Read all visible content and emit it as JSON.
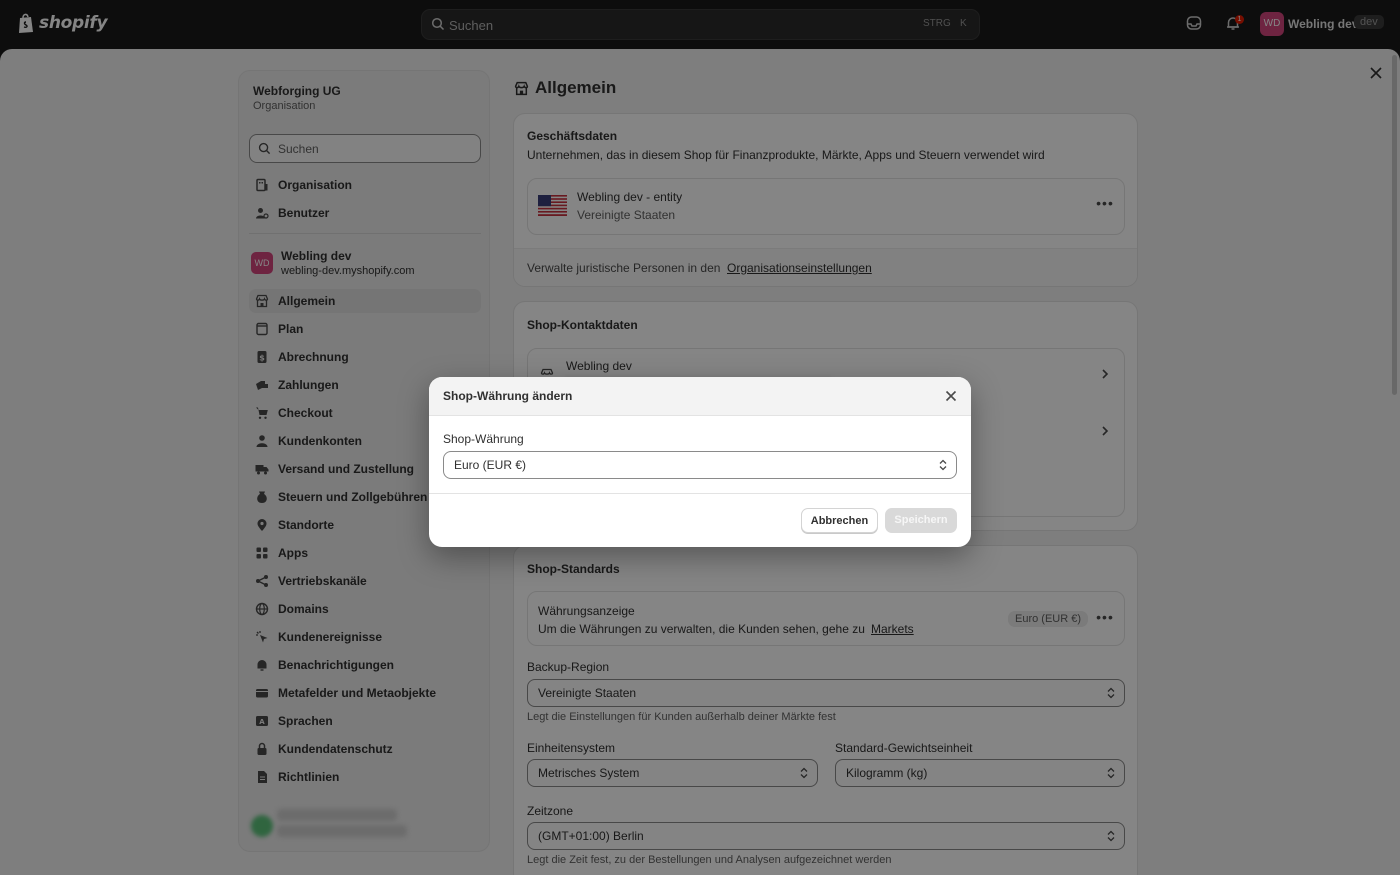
{
  "topbar": {
    "logo_text": "shopify",
    "search_placeholder": "Suchen",
    "shortcut_key1": "STRG",
    "shortcut_key2": "K",
    "notification_count": "1",
    "avatar_initials": "WD",
    "store_name": "Webling dev",
    "store_badge": "dev"
  },
  "sidebar": {
    "org_name": "Webforging UG",
    "org_subtitle": "Organisation",
    "search_placeholder": "Suchen",
    "org_items": [
      {
        "label": "Organisation",
        "icon": "building-icon"
      },
      {
        "label": "Benutzer",
        "icon": "user-icon"
      }
    ],
    "store": {
      "avatar": "WD",
      "name": "Webling dev",
      "url": "webling-dev.myshopify.com"
    },
    "items": [
      {
        "label": "Allgemein",
        "icon": "store-icon",
        "active": true
      },
      {
        "label": "Plan",
        "icon": "plan-icon"
      },
      {
        "label": "Abrechnung",
        "icon": "billing-icon"
      },
      {
        "label": "Zahlungen",
        "icon": "payments-icon"
      },
      {
        "label": "Checkout",
        "icon": "cart-icon"
      },
      {
        "label": "Kundenkonten",
        "icon": "person-icon"
      },
      {
        "label": "Versand und Zustellung",
        "icon": "truck-icon"
      },
      {
        "label": "Steuern und Zollgebühren",
        "icon": "tax-icon"
      },
      {
        "label": "Standorte",
        "icon": "location-icon"
      },
      {
        "label": "Apps",
        "icon": "apps-icon"
      },
      {
        "label": "Vertriebskanäle",
        "icon": "channels-icon"
      },
      {
        "label": "Domains",
        "icon": "globe-icon"
      },
      {
        "label": "Kundenereignisse",
        "icon": "cursor-icon"
      },
      {
        "label": "Benachrichtigungen",
        "icon": "bell-icon"
      },
      {
        "label": "Metafelder und Metaobjekte",
        "icon": "metafields-icon"
      },
      {
        "label": "Sprachen",
        "icon": "language-icon"
      },
      {
        "label": "Kundendatenschutz",
        "icon": "lock-icon"
      },
      {
        "label": "Richtlinien",
        "icon": "policy-icon"
      }
    ]
  },
  "main": {
    "page_title": "Allgemein",
    "business": {
      "title": "Geschäftsdaten",
      "subtitle": "Unternehmen, das in diesem Shop für Finanzprodukte, Märkte, Apps und Steuern verwendet wird",
      "entity_name": "Webling dev - entity",
      "entity_country": "Vereinigte Staaten",
      "footer_text": "Verwalte juristische Personen in den",
      "footer_link": "Organisationseinstellungen"
    },
    "contact": {
      "title": "Shop-Kontaktdaten",
      "store_name": "Webling dev"
    },
    "defaults": {
      "title": "Shop-Standards",
      "currency_display_title": "Währungsanzeige",
      "currency_display_text": "Um die Währungen zu verwalten, die Kunden sehen, gehe zu",
      "currency_display_link": "Markets",
      "currency_pill": "Euro (EUR €)",
      "backup_region_label": "Backup-Region",
      "backup_region_value": "Vereinigte Staaten",
      "backup_region_help": "Legt die Einstellungen für Kunden außerhalb deiner Märkte fest",
      "unit_system_label": "Einheitensystem",
      "unit_system_value": "Metrisches System",
      "weight_unit_label": "Standard-Gewichtseinheit",
      "weight_unit_value": "Kilogramm (kg)",
      "timezone_label": "Zeitzone",
      "timezone_value": "(GMT+01:00) Berlin",
      "timezone_help": "Legt die Zeit fest, zu der Bestellungen und Analysen aufgezeichnet werden"
    }
  },
  "modal": {
    "title": "Shop-Währung ändern",
    "field_label": "Shop-Währung",
    "selected_value": "Euro (EUR €)",
    "cancel_label": "Abbrechen",
    "save_label": "Speichern"
  }
}
